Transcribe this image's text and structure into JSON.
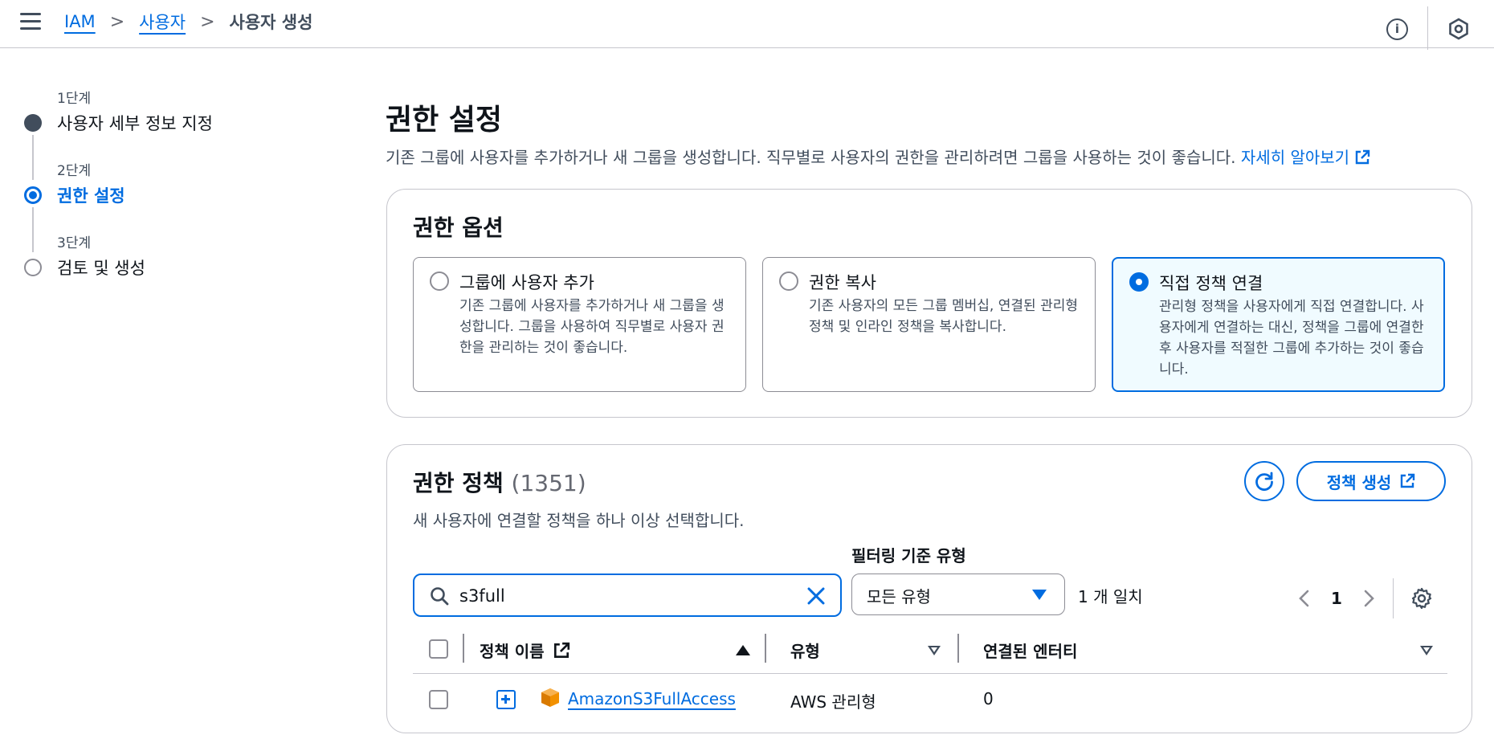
{
  "breadcrumb": {
    "root": "IAM",
    "parent": "사용자",
    "current": "사용자 생성"
  },
  "steps": [
    {
      "sub": "1단계",
      "name": "사용자 세부 정보 지정",
      "state": "done"
    },
    {
      "sub": "2단계",
      "name": "권한 설정",
      "state": "active"
    },
    {
      "sub": "3단계",
      "name": "검토 및 생성",
      "state": "todo"
    }
  ],
  "page": {
    "title": "권한 설정",
    "description": "기존 그룹에 사용자를 추가하거나 새 그룹을 생성합니다. 직무별로 사용자의 권한을 관리하려면 그룹을 사용하는 것이 좋습니다.",
    "learn_more": "자세히 알아보기"
  },
  "options": {
    "title": "권한 옵션",
    "items": [
      {
        "title": "그룹에 사용자 추가",
        "desc": "기존 그룹에 사용자를 추가하거나 새 그룹을 생성합니다. 그룹을 사용하여 직무별로 사용자 권한을 관리하는 것이 좋습니다.",
        "selected": false
      },
      {
        "title": "권한 복사",
        "desc": "기존 사용자의 모든 그룹 멤버십, 연결된 관리형 정책 및 인라인 정책을 복사합니다.",
        "selected": false
      },
      {
        "title": "직접 정책 연결",
        "desc": "관리형 정책을 사용자에게 직접 연결합니다. 사용자에게 연결하는 대신, 정책을 그룹에 연결한 후 사용자를 적절한 그룹에 추가하는 것이 좋습니다.",
        "selected": true
      }
    ]
  },
  "policies": {
    "title": "권한 정책",
    "count": "(1351)",
    "description": "새 사용자에 연결할 정책을 하나 이상 선택합니다.",
    "create_button": "정책 생성",
    "filter_label": "필터링 기준 유형",
    "search_value": "s3full",
    "filter_value": "모든 유형",
    "matches": "1 개 일치",
    "page": "1",
    "columns": {
      "name": "정책 이름",
      "type": "유형",
      "entities": "연결된 엔터티"
    },
    "rows": [
      {
        "name": "AmazonS3FullAccess",
        "type": "AWS 관리형",
        "entities": "0"
      }
    ]
  },
  "colors": {
    "accent": "#006ce0",
    "text": "#0f141a",
    "muted": "#414d5c",
    "border": "#c6c6cd",
    "selected_bg": "#f0fbff",
    "aws_orange": "#f29100"
  }
}
